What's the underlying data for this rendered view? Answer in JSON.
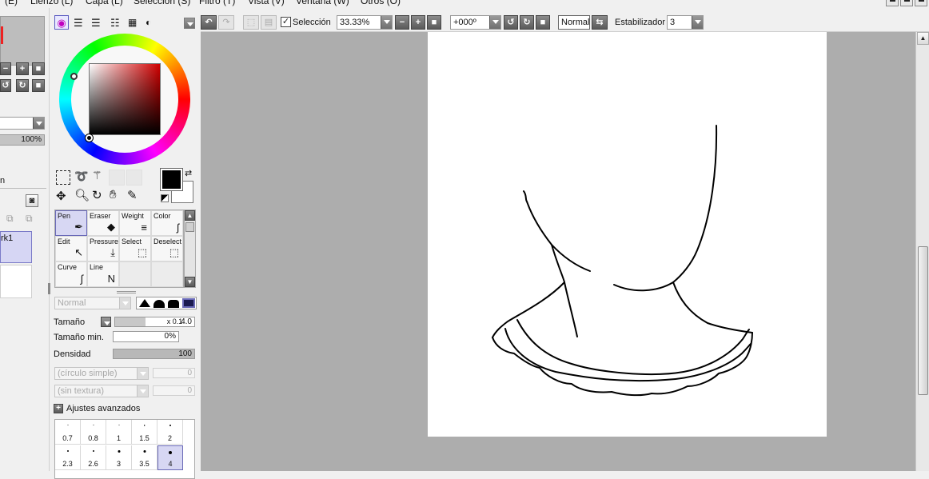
{
  "menu": {
    "items": [
      "(E)",
      "Lienzo (L)",
      "Capa (L)",
      "Selección (S)",
      "Filtro (T)",
      "Vista (V)",
      "Ventana (W)",
      "Otros (O)"
    ]
  },
  "toolbar": {
    "selection_label": "Selección",
    "selection_checked": true,
    "zoom_value": "33.33%",
    "rotation_value": "+000º",
    "mode_value": "Normal",
    "stabilizer_label": "Estabilizador",
    "stabilizer_value": "3"
  },
  "left_strip": {
    "opacity_value": "100%",
    "layer_name": "rk1",
    "fragment_label": "n"
  },
  "color_panel": {
    "primary_color": "#000000",
    "secondary_color": "#ffffff",
    "hue_color": "#d00000"
  },
  "tools": {
    "items": [
      {
        "label": "Pen",
        "icon": "pen-icon"
      },
      {
        "label": "Eraser",
        "icon": "eraser-icon"
      },
      {
        "label": "Weight",
        "icon": "weight-icon"
      },
      {
        "label": "Color",
        "icon": "color-icon"
      },
      {
        "label": "Edit",
        "icon": "edit-icon"
      },
      {
        "label": "Pressure",
        "icon": "pressure-icon"
      },
      {
        "label": "Select",
        "icon": "select-icon"
      },
      {
        "label": "Deselect",
        "icon": "deselect-icon"
      },
      {
        "label": "Curve",
        "icon": "curve-icon"
      },
      {
        "label": "Line",
        "icon": "line-icon"
      }
    ],
    "selected": "Pen"
  },
  "brush_settings": {
    "blend_mode": "Normal",
    "size_label": "Tamaño",
    "size_multiplier": "x 0.1",
    "size_value": "4.0",
    "min_size_label": "Tamaño min.",
    "min_size_value": "0%",
    "density_label": "Densidad",
    "density_value": "100",
    "shape_value": "(círculo simple)",
    "shape_amount": "0",
    "texture_value": "(sin textura)",
    "texture_amount": "0",
    "advanced_label": "Ajustes avanzados"
  },
  "brush_sizes": {
    "values": [
      "0.7",
      "0.8",
      "1",
      "1.5",
      "2",
      "2.3",
      "2.6",
      "3",
      "3.5",
      "4"
    ],
    "selected": "4"
  }
}
